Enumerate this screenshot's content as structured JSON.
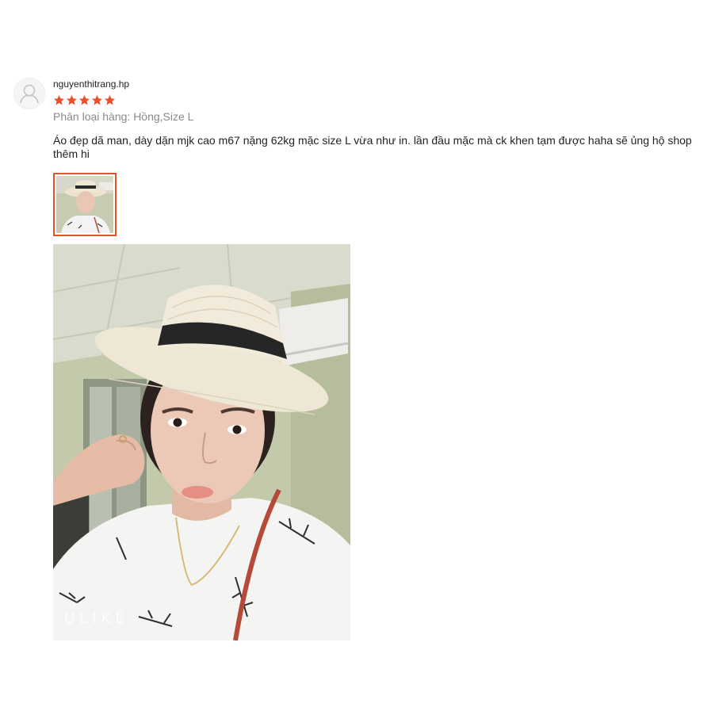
{
  "review": {
    "username": "nguyenthitrang.hp",
    "rating": 5,
    "rating_max": 5,
    "variation": "Phân loại hàng: Hồng,Size L",
    "comment": "Áo đẹp dã man, dày dặn mjk cao m67 nặng 62kg mặc size L vừa như in. lần đầu mặc mà ck khen tạm được haha sẽ ủng hộ shop thêm hi",
    "photo_watermark": "ULIKE"
  },
  "icons": {
    "avatar": "user-avatar-icon",
    "star": "star-icon"
  },
  "colors": {
    "star": "#ee4d2d",
    "thumb_border": "#e0542b",
    "username": "#222222",
    "variation": "#8a8a8a",
    "comment": "#222222",
    "avatar_bg": "#f5f5f5"
  }
}
